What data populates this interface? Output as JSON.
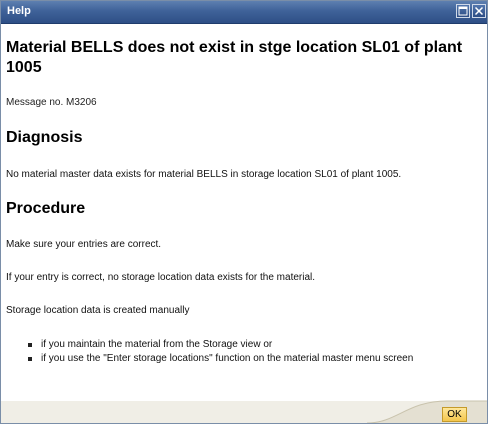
{
  "window": {
    "title": "Help"
  },
  "message": {
    "heading": "Material BELLS does not exist in stge location SL01 of plant 1005",
    "message_number": "Message no. M3206"
  },
  "diagnosis": {
    "heading": "Diagnosis",
    "text": "No material master data exists for material BELLS in storage location SL01 of plant 1005."
  },
  "procedure": {
    "heading": "Procedure",
    "paragraphs": [
      "Make sure your entries are correct.",
      "If your entry is correct, no storage location data exists for the material.",
      "Storage location data is created manually"
    ],
    "bullets": [
      "if you maintain the material from the Storage view or",
      "if you use the \"Enter storage locations\" function on the material master menu screen"
    ]
  },
  "footer": {
    "ok_label": "OK"
  },
  "colors": {
    "titlebar": "#3f6299",
    "ok_button": "#f4c64c",
    "footer": "#f0eee6"
  }
}
